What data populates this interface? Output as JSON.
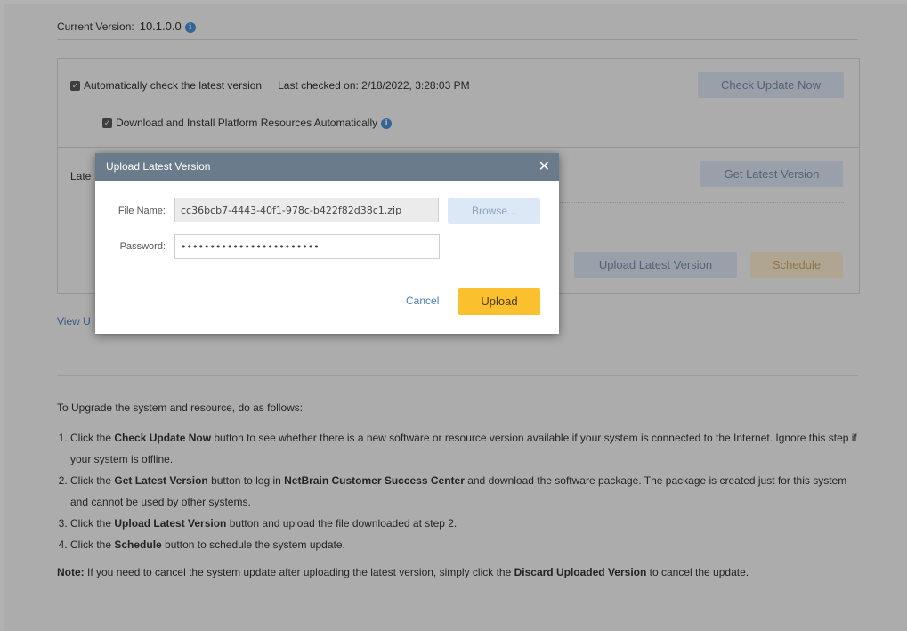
{
  "header": {
    "current_version_label": "Current Version:",
    "current_version_value": "10.1.0.0"
  },
  "settings": {
    "auto_check_label": "Automatically check the latest version",
    "last_checked": "Last checked on: 2/18/2022, 3:28:03 PM",
    "auto_install_label": "Download and Install Platform Resources Automatically",
    "check_update_button": "Check Update Now",
    "latest_label": "Late",
    "get_latest_button": "Get Latest Version",
    "upload_latest_button": "Upload Latest Version",
    "schedule_button": "Schedule",
    "view_link": "View U"
  },
  "instructions": {
    "intro": "To Upgrade the system and resource, do as follows:",
    "steps": [
      {
        "pre": "Click the ",
        "bold": "Check Update Now",
        "post": " button to see whether there is a new software or resource version available if your system is connected to the Internet. Ignore this step if your system is offline."
      },
      {
        "pre": "Click the ",
        "bold": "Get Latest Version",
        "mid": " button to log in ",
        "bold2": "NetBrain Customer Success Center",
        "post": " and download the software package. The package is created just for this system and cannot be used by other systems."
      },
      {
        "pre": "Click the ",
        "bold": "Upload Latest Version",
        "post": " button and upload the file downloaded at step 2."
      },
      {
        "pre": "Click the ",
        "bold": "Schedule",
        "post": " button to schedule the system update."
      }
    ],
    "note_label": "Note:",
    "note_pre": " If you need to cancel the system update after uploading the latest version, simply click the ",
    "note_bold": "Discard Uploaded Version",
    "note_post": " to cancel the update."
  },
  "dialog": {
    "title": "Upload Latest Version",
    "file_name_label": "File Name:",
    "file_name_value": "cc36bcb7-4443-40f1-978c-b422f82d38c1.zip",
    "browse_button": "Browse...",
    "password_label": "Password:",
    "password_value": "••••••••••••••••••••••••",
    "cancel_button": "Cancel",
    "upload_button": "Upload"
  }
}
